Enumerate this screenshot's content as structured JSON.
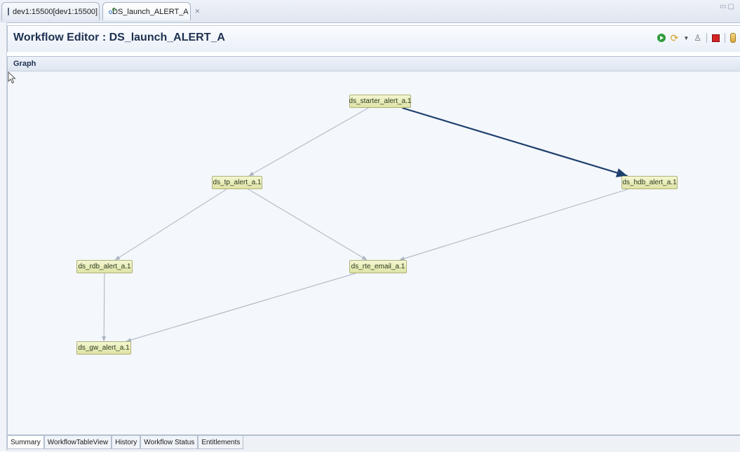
{
  "tabs": [
    {
      "label": "dev1:15500[dev1:15500]",
      "icon": "database-icon"
    },
    {
      "label": "DS_launch_ALERT_A",
      "icon": "workflow-icon",
      "closable": true
    }
  ],
  "editor": {
    "title": "Workflow Editor : DS_launch_ALERT_A",
    "toolbar": [
      "run-icon",
      "workflow-action-icon",
      "dropdown-icon",
      "user-icon",
      "stop-icon",
      "info-icon"
    ]
  },
  "section": {
    "title": "Graph"
  },
  "graph": {
    "nodes": [
      {
        "id": "starter",
        "label": "ds_starter_alert_a.1"
      },
      {
        "id": "tp",
        "label": "ds_tp_alert_a.1"
      },
      {
        "id": "hdb",
        "label": "ds_hdb_alert_a.1"
      },
      {
        "id": "rdb",
        "label": "ds_rdb_alert_a.1"
      },
      {
        "id": "rte",
        "label": "ds_rte_email_a.1"
      },
      {
        "id": "gw",
        "label": "ds_gw_alert_a.1"
      }
    ],
    "edges": [
      {
        "from": "starter",
        "to": "tp",
        "highlighted": false
      },
      {
        "from": "starter",
        "to": "hdb",
        "highlighted": true
      },
      {
        "from": "tp",
        "to": "rdb",
        "highlighted": false
      },
      {
        "from": "tp",
        "to": "rte",
        "highlighted": false
      },
      {
        "from": "hdb",
        "to": "rte",
        "highlighted": false
      },
      {
        "from": "rdb",
        "to": "gw",
        "highlighted": false
      },
      {
        "from": "rte",
        "to": "gw",
        "highlighted": false
      }
    ]
  },
  "bottom_tabs": [
    {
      "label": "Summary",
      "active": true
    },
    {
      "label": "WorkflowTableView",
      "active": false
    },
    {
      "label": "History",
      "active": false
    },
    {
      "label": "Workflow Status",
      "active": false
    },
    {
      "label": "Entitlements",
      "active": false
    }
  ],
  "colors": {
    "node_fill": "#e8ebb8",
    "edge": "#a9b2c0",
    "edge_highlight": "#1d3f6e",
    "title": "#1f3150"
  }
}
